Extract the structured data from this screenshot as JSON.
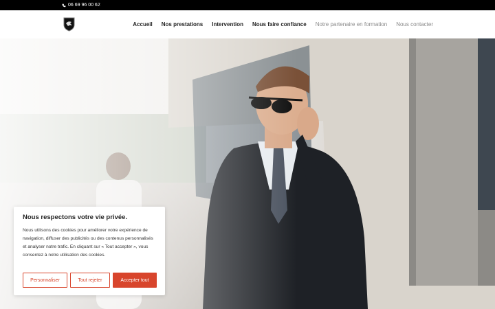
{
  "topbar": {
    "phone": "06 69 96 00 62"
  },
  "nav": {
    "items": [
      {
        "label": "Accueil"
      },
      {
        "label": "Nos prestations"
      },
      {
        "label": "Intervention"
      },
      {
        "label": "Nous faire confiance"
      },
      {
        "label": "Notre partenaire en formation"
      },
      {
        "label": "Nous contacter"
      }
    ]
  },
  "cookie": {
    "title": "Nous respectons votre vie privée.",
    "text": "Nous utilisons des cookies pour améliorer votre expérience de navigation, diffuser des publicités ou des contenus personnalisés et analyser notre trafic. En cliquant sur « Tout accepter », vous consentez à notre utilisation des cookies.",
    "customize_label": "Personnaliser",
    "reject_label": "Tout rejeter",
    "accept_label": "Accepter tout"
  },
  "colors": {
    "accent": "#d8452c",
    "topbar": "#000000"
  },
  "icons": {
    "phone": "phone-icon",
    "logo": "shield-logo-icon"
  }
}
